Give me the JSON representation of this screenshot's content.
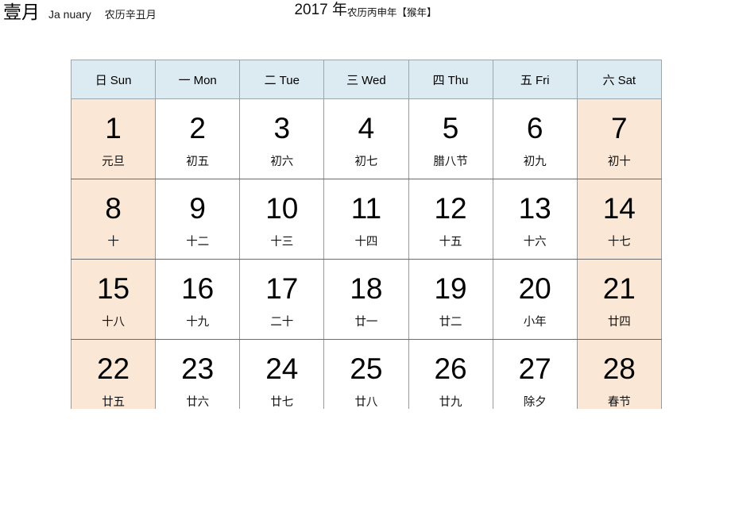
{
  "header": {
    "month_cn": "壹月",
    "month_en": "Ja nuary",
    "month_lunar": "农历辛丑月",
    "year_num": "2017 年",
    "year_lunar": "农历丙申年【猴年】"
  },
  "calendar": {
    "weekdays": [
      {
        "cn": "日",
        "en": "Sun",
        "weekend": true
      },
      {
        "cn": "一",
        "en": "Mon",
        "weekend": false
      },
      {
        "cn": "二",
        "en": "Tue",
        "weekend": false
      },
      {
        "cn": "三",
        "en": "Wed",
        "weekend": false
      },
      {
        "cn": "四",
        "en": "Thu",
        "weekend": false
      },
      {
        "cn": "五",
        "en": "Fri",
        "weekend": false
      },
      {
        "cn": "六",
        "en": "Sat",
        "weekend": true
      }
    ],
    "weeks": [
      [
        {
          "day": "1",
          "lunar": "元旦",
          "weekend": true
        },
        {
          "day": "2",
          "lunar": "初五",
          "weekend": false
        },
        {
          "day": "3",
          "lunar": "初六",
          "weekend": false
        },
        {
          "day": "4",
          "lunar": "初七",
          "weekend": false
        },
        {
          "day": "5",
          "lunar": "腊八节",
          "weekend": false
        },
        {
          "day": "6",
          "lunar": "初九",
          "weekend": false
        },
        {
          "day": "7",
          "lunar": "初十",
          "weekend": true
        }
      ],
      [
        {
          "day": "8",
          "lunar": "十",
          "weekend": true
        },
        {
          "day": "9",
          "lunar": "十二",
          "weekend": false
        },
        {
          "day": "10",
          "lunar": "十三",
          "weekend": false
        },
        {
          "day": "11",
          "lunar": "十四",
          "weekend": false
        },
        {
          "day": "12",
          "lunar": "十五",
          "weekend": false
        },
        {
          "day": "13",
          "lunar": "十六",
          "weekend": false
        },
        {
          "day": "14",
          "lunar": "十七",
          "weekend": true
        }
      ],
      [
        {
          "day": "15",
          "lunar": "十八",
          "weekend": true
        },
        {
          "day": "16",
          "lunar": "十九",
          "weekend": false
        },
        {
          "day": "17",
          "lunar": "二十",
          "weekend": false
        },
        {
          "day": "18",
          "lunar": "廿一",
          "weekend": false
        },
        {
          "day": "19",
          "lunar": "廿二",
          "weekend": false
        },
        {
          "day": "20",
          "lunar": "小年",
          "weekend": false
        },
        {
          "day": "21",
          "lunar": "廿四",
          "weekend": true
        }
      ],
      [
        {
          "day": "22",
          "lunar": "廿五",
          "weekend": true
        },
        {
          "day": "23",
          "lunar": "廿六",
          "weekend": false
        },
        {
          "day": "24",
          "lunar": "廿七",
          "weekend": false
        },
        {
          "day": "25",
          "lunar": "廿八",
          "weekend": false
        },
        {
          "day": "26",
          "lunar": "廿九",
          "weekend": false
        },
        {
          "day": "27",
          "lunar": "除夕",
          "weekend": false
        },
        {
          "day": "28",
          "lunar": "春节",
          "weekend": true
        }
      ]
    ]
  },
  "colors": {
    "weekday_header_bg": "#dcebf2",
    "weekend_bg": "#fae7d6",
    "grid_line": "#9a9a9a",
    "text": "#000000"
  }
}
